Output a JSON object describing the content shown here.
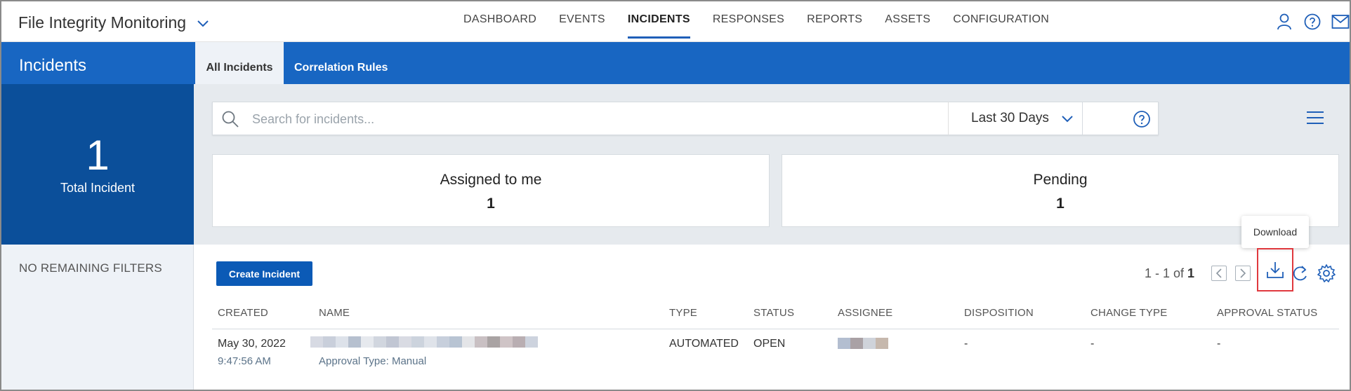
{
  "app": {
    "title": "File Integrity Monitoring"
  },
  "nav": {
    "items": [
      {
        "label": "DASHBOARD",
        "active": false
      },
      {
        "label": "EVENTS",
        "active": false
      },
      {
        "label": "INCIDENTS",
        "active": true
      },
      {
        "label": "RESPONSES",
        "active": false
      },
      {
        "label": "REPORTS",
        "active": false
      },
      {
        "label": "ASSETS",
        "active": false
      },
      {
        "label": "CONFIGURATION",
        "active": false
      }
    ]
  },
  "sidebar": {
    "title": "Incidents",
    "total_count": "1",
    "total_label": "Total Incident",
    "filters_label": "NO REMAINING FILTERS"
  },
  "tabs": [
    {
      "label": "All Incidents",
      "active": true
    },
    {
      "label": "Correlation Rules",
      "active": false
    }
  ],
  "search": {
    "placeholder": "Search for incidents...",
    "value": ""
  },
  "date_range": {
    "selected": "Last 30 Days"
  },
  "stats": [
    {
      "title": "Assigned to me",
      "value": "1"
    },
    {
      "title": "Pending",
      "value": "1"
    }
  ],
  "toolbar": {
    "create_label": "Create Incident",
    "pager_range": "1 - 1 of",
    "pager_total": "1",
    "download_tooltip": "Download"
  },
  "table": {
    "columns": [
      "CREATED",
      "NAME",
      "TYPE",
      "STATUS",
      "ASSIGNEE",
      "DISPOSITION",
      "CHANGE TYPE",
      "APPROVAL STATUS"
    ],
    "rows": [
      {
        "created_date": "May 30, 2022",
        "created_time": "9:47:56 AM",
        "name_sub": "Approval Type: Manual",
        "type": "AUTOMATED",
        "status": "OPEN",
        "disposition": "-",
        "change_type": "-",
        "approval_status": "-"
      }
    ]
  },
  "colors": {
    "primary": "#1866c2",
    "primary_dark": "#0b4f9a",
    "highlight": "#e0393e"
  }
}
